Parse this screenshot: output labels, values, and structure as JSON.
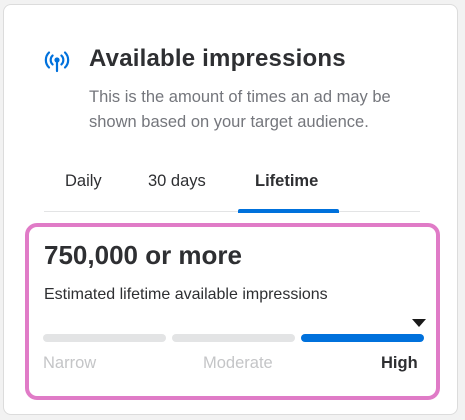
{
  "card": {
    "icon": "broadcast-signal-icon",
    "title": "Available impressions",
    "description": "This is the amount of times an ad may be shown based on your target audience."
  },
  "tabs": [
    {
      "label": "Daily",
      "active": false
    },
    {
      "label": "30 days",
      "active": false
    },
    {
      "label": "Lifetime",
      "active": true
    }
  ],
  "result": {
    "value": "750,000 or more",
    "label": "Estimated lifetime available impressions",
    "scale": [
      "Narrow",
      "Moderate",
      "High"
    ],
    "selected_level": "High"
  },
  "colors": {
    "accent": "#0071dc",
    "highlight_border": "#e07bc7",
    "text_primary": "#2e2f32",
    "text_secondary": "#74767c"
  }
}
